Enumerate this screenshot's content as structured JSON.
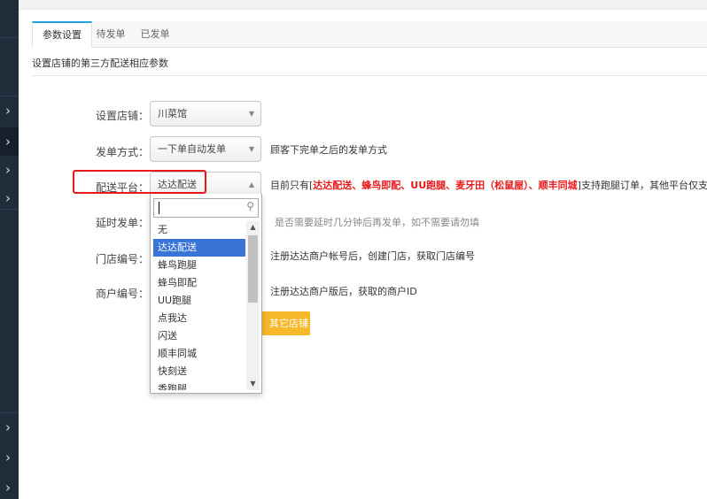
{
  "tabs": [
    {
      "label": "参数设置",
      "active": true
    },
    {
      "label": "待发单",
      "active": false
    },
    {
      "label": "已发单",
      "active": false
    }
  ],
  "description": "设置店铺的第三方配送相应参数",
  "form": {
    "store": {
      "label": "设置店铺：",
      "value": "川菜馆"
    },
    "dispatch_mode": {
      "label": "发单方式：",
      "value": "一下单自动发单",
      "hint": "顾客下完单之后的发单方式"
    },
    "platform": {
      "label": "配送平台：",
      "value": "达达配送",
      "hint_prefix": "目前只有[",
      "hint_highlight": "达达配送、蜂鸟即配、UU跑腿、麦牙田（松鼠屋）、顺丰同城",
      "hint_suffix": "]支持跑腿订单，其他平台仅支持店铺"
    },
    "delay": {
      "label": "延时发单：",
      "hint": "是否需要延时几分钟后再发单，如不需要请勿填"
    },
    "store_code": {
      "label": "门店编号：",
      "hint": "注册达达商户帐号后，创建门店，获取门店编号"
    },
    "merchant_code": {
      "label": "商户编号：",
      "hint": "注册达达商户版后，获取的商户ID"
    },
    "other_store_button": "其它店铺"
  },
  "dropdown": {
    "search_value": "",
    "options": [
      "无",
      "达达配送",
      "蜂鸟跑腿",
      "蜂鸟即配",
      "UU跑腿",
      "点我达",
      "闪送",
      "顺丰同城",
      "快刻送",
      "香跑腿"
    ],
    "selected_index": 1
  },
  "icons": {
    "sidebar_chevron": "chevron-right-icon",
    "select_arrow": "triangle-down-icon",
    "search": "search-icon"
  },
  "colors": {
    "accent_tab": "#23a2d9",
    "highlight_red": "#e8191b",
    "selected_option": "#3875d7",
    "button_yellow": "#f7b82a",
    "sidebar": "#1f2c3a"
  }
}
